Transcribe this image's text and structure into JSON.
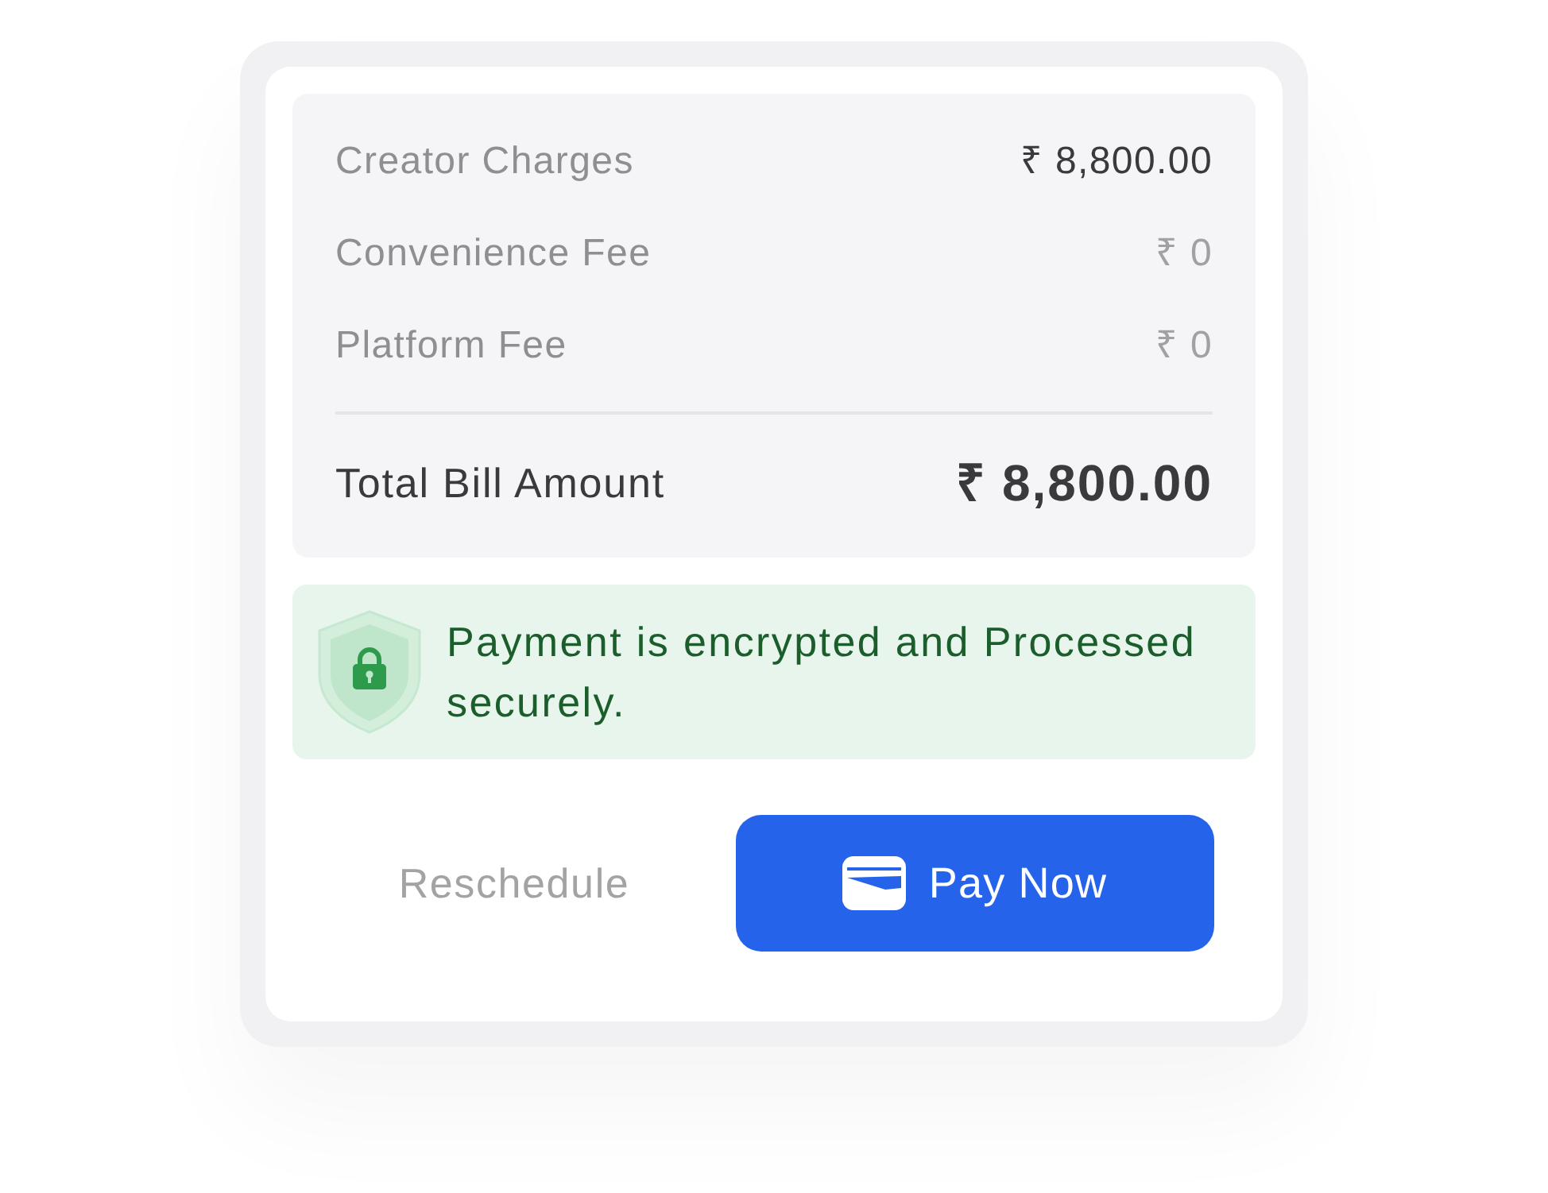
{
  "bill": {
    "items": [
      {
        "label": "Creator Charges",
        "amount": "₹ 8,800.00",
        "highlighted": true
      },
      {
        "label": "Convenience Fee",
        "amount": "₹ 0",
        "highlighted": false
      },
      {
        "label": "Platform Fee",
        "amount": "₹ 0",
        "highlighted": false
      }
    ],
    "total": {
      "label": "Total Bill Amount",
      "amount": "₹ 8,800.00"
    }
  },
  "security_notice": {
    "text": "Payment is encrypted and Processed securely."
  },
  "actions": [
    {
      "label": "Reschedule",
      "kind": "text"
    },
    {
      "label": "Pay Now",
      "kind": "primary"
    }
  ]
}
